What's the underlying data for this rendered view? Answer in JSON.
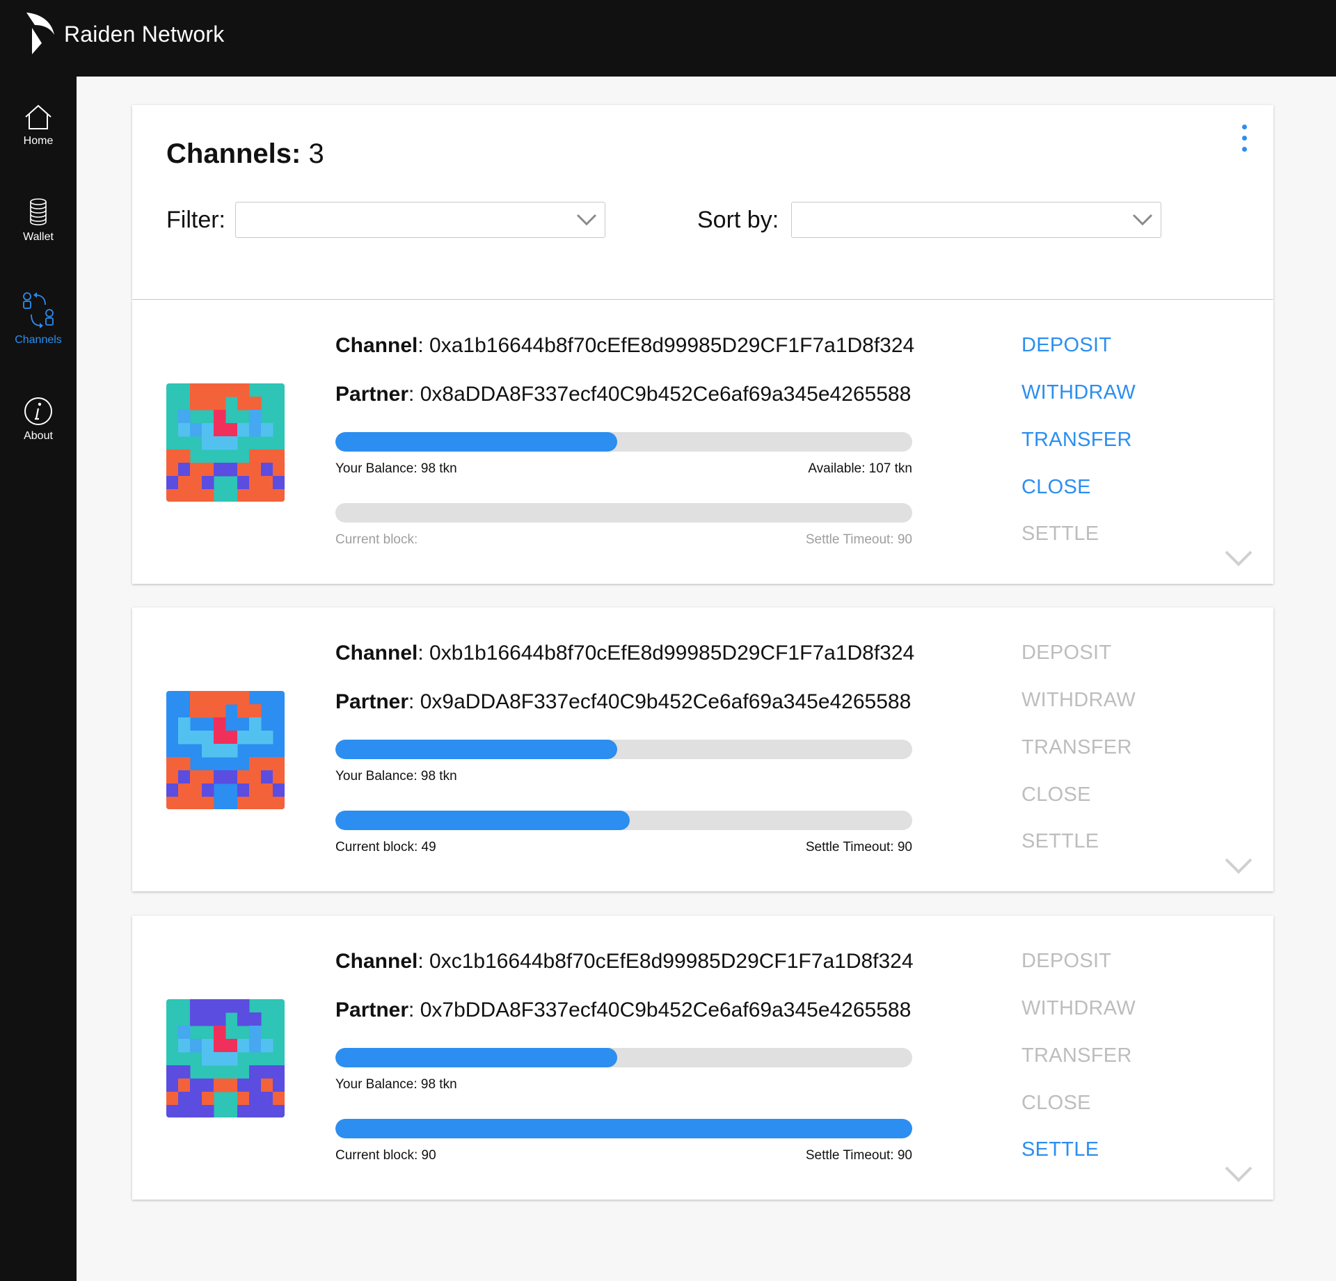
{
  "app": {
    "title": "Raiden Network"
  },
  "sidebar": {
    "items": [
      {
        "label": "Home",
        "icon": "home-icon",
        "active": false
      },
      {
        "label": "Wallet",
        "icon": "coins-icon",
        "active": false
      },
      {
        "label": "Channels",
        "icon": "channels-icon",
        "active": true
      },
      {
        "label": "About",
        "icon": "info-icon",
        "active": false
      }
    ]
  },
  "header": {
    "count_label": "Channels:",
    "count_value": "3",
    "filter_label": "Filter:",
    "filter_value": "",
    "sort_label": "Sort by:",
    "sort_value": ""
  },
  "colors": {
    "accent": "#2b8ef0",
    "topbar": "#111111",
    "disabled": "#bdbdbd"
  },
  "channels": [
    {
      "channel_label": "Channel",
      "channel": "0xa1b16644b8f70cEfE8d99985D29CF1F7a1D8f324",
      "partner_label": "Partner",
      "partner": "0x8aDDA8F337ecf40C9b452Ce6af69a345e4265588",
      "balance_text": "Your Balance: 98 tkn",
      "available_text": "Available:  107 tkn",
      "balance_fraction": 0.488,
      "block_text": "Current block:",
      "timeout_text": "Settle Timeout: 90",
      "block_fraction": 0,
      "block_dim": true,
      "actions": [
        {
          "label": "DEPOSIT",
          "enabled": true
        },
        {
          "label": "WITHDRAW",
          "enabled": true
        },
        {
          "label": "TRANSFER",
          "enabled": true
        },
        {
          "label": "CLOSE",
          "enabled": true
        },
        {
          "label": "SETTLE",
          "enabled": false
        }
      ],
      "avatar": {
        "bg": "#2ec4b6",
        "accent": "#f4623a",
        "shade": "#45a8f0",
        "eyes": "#f0305a",
        "extra": "#5b4de0",
        "mouth": "#52c1f0"
      }
    },
    {
      "channel_label": "Channel",
      "channel": "0xb1b16644b8f70cEfE8d99985D29CF1F7a1D8f324",
      "partner_label": "Partner",
      "partner": "0x9aDDA8F337ecf40C9b452Ce6af69a345e4265588",
      "balance_text": "Your Balance: 98 tkn",
      "available_text": "",
      "balance_fraction": 0.488,
      "block_text": "Current block: 49",
      "timeout_text": "Settle Timeout: 90",
      "block_fraction": 0.51,
      "block_dim": false,
      "actions": [
        {
          "label": "DEPOSIT",
          "enabled": false
        },
        {
          "label": "WITHDRAW",
          "enabled": false
        },
        {
          "label": "TRANSFER",
          "enabled": false
        },
        {
          "label": "CLOSE",
          "enabled": false
        },
        {
          "label": "SETTLE",
          "enabled": false
        }
      ],
      "avatar": {
        "bg": "#2b8ef0",
        "accent": "#f4623a",
        "shade": "#52c1f0",
        "eyes": "#f0305a",
        "extra": "#5b4de0",
        "mouth": "#52c1f0"
      }
    },
    {
      "channel_label": "Channel",
      "channel": "0xc1b16644b8f70cEfE8d99985D29CF1F7a1D8f324",
      "partner_label": "Partner",
      "partner": "0x7bDDA8F337ecf40C9b452Ce6af69a345e4265588",
      "balance_text": "Your Balance: 98 tkn",
      "available_text": "",
      "balance_fraction": 0.488,
      "block_text": "Current block: 90",
      "timeout_text": "Settle Timeout: 90",
      "block_fraction": 1.0,
      "block_dim": false,
      "actions": [
        {
          "label": "DEPOSIT",
          "enabled": false
        },
        {
          "label": "WITHDRAW",
          "enabled": false
        },
        {
          "label": "TRANSFER",
          "enabled": false
        },
        {
          "label": "CLOSE",
          "enabled": false
        },
        {
          "label": "SETTLE",
          "enabled": true
        }
      ],
      "avatar": {
        "bg": "#2ec4b6",
        "accent": "#5b4de0",
        "shade": "#45a8f0",
        "eyes": "#f0305a",
        "extra": "#f4623a",
        "mouth": "#52c1f0"
      }
    }
  ]
}
